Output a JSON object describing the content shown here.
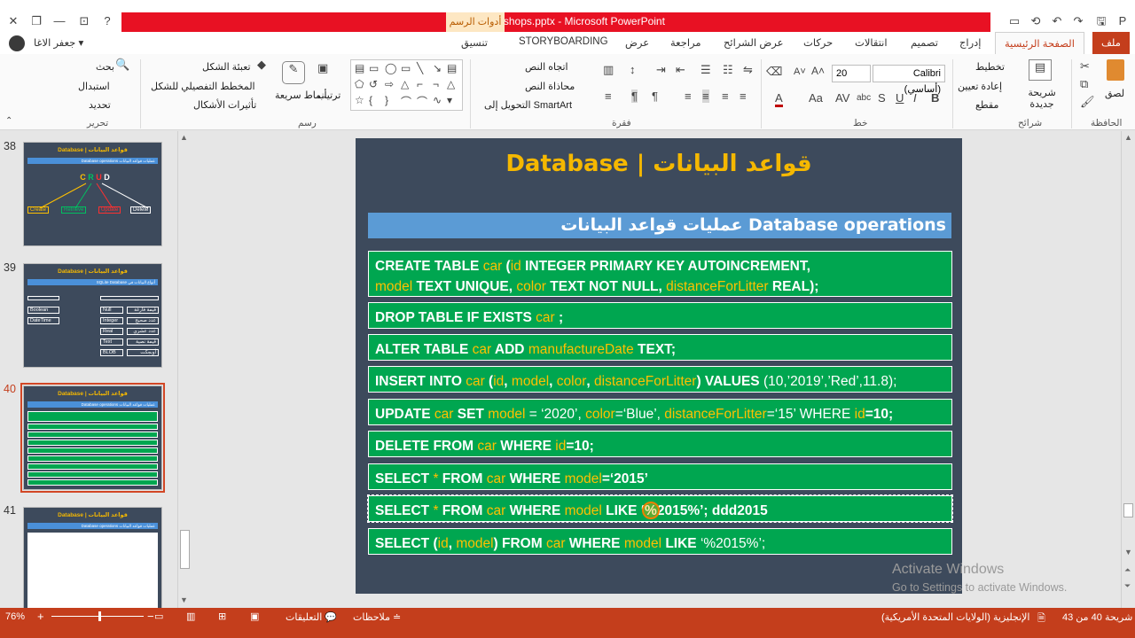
{
  "window": {
    "title": "1 Workshops.pptx  -  Microsoft PowerPoint",
    "context_tab": "أدوات الرسم",
    "user": "جعفر الاغا",
    "help": "?"
  },
  "tabs": {
    "file": "ملف",
    "home": "الصفحة الرئيسية",
    "insert": "إدراج",
    "design": "تصميم",
    "transitions": "انتقالات",
    "animations": "حركات",
    "slideshow": "عرض الشرائح",
    "review": "مراجعة",
    "view": "عرض",
    "storyboarding": "STORYBOARDING",
    "format": "تنسيق"
  },
  "ribbon": {
    "clipboard": {
      "label": "الحافظة",
      "paste": "لصق"
    },
    "slides": {
      "label": "شرائح",
      "new_slide": "شريحة جديدة",
      "layout": "تخطيط",
      "reset": "إعادة تعيين",
      "section": "مقطع"
    },
    "font": {
      "label": "خط",
      "font_name": "Calibri (أساسي)",
      "font_size": "20"
    },
    "paragraph": {
      "label": "فقرة",
      "text_direction": "اتجاه النص",
      "align_text": "محاذاة النص",
      "smartart": "التحويل إلى SmartArt"
    },
    "drawing": {
      "label": "رسم",
      "arrange": "ترتيب",
      "quick_styles": "أنماط سريعة",
      "shape_fill": "تعبئة الشكل",
      "shape_outline": "المخطط التفصيلي للشكل",
      "shape_effects": "تأثيرات الأشكال"
    },
    "editing": {
      "label": "تحرير",
      "find": "بحث",
      "replace": "استبدال",
      "select": "تحديد"
    }
  },
  "thumbnails": [
    {
      "number": "38",
      "title": "Database | قواعد البيانات",
      "band": "Database operations عمليات قواعد البيانات"
    },
    {
      "number": "39",
      "title": "Database | قواعد البيانات",
      "band": "SQLite Database أنواع البيانات في"
    },
    {
      "number": "40",
      "title": "Database | قواعد البيانات",
      "band": "Database operations عمليات قواعد البيانات"
    },
    {
      "number": "41",
      "title": "Database | قواعد البيانات",
      "band": "Database operations عمليات قواعد البيانات"
    }
  ],
  "thumb38": {
    "c": "C",
    "r": "R",
    "u": "U",
    "d": "D",
    "create": "Create",
    "retrieve": "Retrieve",
    "update": "Update",
    "delete": "Delete"
  },
  "thumb39": {
    "boolean": "Boolean",
    "datetime": "DateTime",
    "null": "Null",
    "integer": "Integer",
    "real": "Real",
    "text": "Text",
    "blob": "BLOB",
    "null_ar": "قيمة فارغة",
    "integer_ar": "عدد صحيح",
    "real_ar": "عدد عشري",
    "text_ar": "قيمة نصية",
    "blob_ar": "أوبجكت"
  },
  "slide": {
    "title": "Database  |  قواعد البيانات",
    "band": "عمليات قواعد البيانات Database operations",
    "rows": [
      {
        "l1": [
          "CREATE TABLE ",
          "car",
          " (",
          "id",
          " INTEGER PRIMARY KEY AUTOINCREMENT,"
        ],
        "l2": [
          "model",
          " TEXT UNIQUE, ",
          "color",
          " TEXT NOT NULL, ",
          "distanceForLitter",
          " REAL);"
        ]
      },
      {
        "p": [
          "DROP TABLE IF EXISTS ",
          "car",
          " ;"
        ]
      },
      {
        "p": [
          "ALTER TABLE ",
          "car",
          " ADD ",
          "manufactureDate",
          " TEXT;"
        ]
      },
      {
        "p": [
          "INSERT INTO ",
          "car",
          " (",
          "id",
          ", ",
          "model",
          ", ",
          "color",
          ", ",
          "distanceForLitter",
          ") VALUES ",
          "(10,’2019’,’Red’,11.8);"
        ]
      },
      {
        "p": [
          "UPDATE ",
          "car",
          " SET ",
          "model",
          " = ‘2020’, ",
          "color",
          "=‘Blue’, ",
          "distanceForLitter",
          "=‘15’ WHERE ",
          "id",
          "=10;"
        ]
      },
      {
        "p": [
          "DELETE FROM ",
          "car",
          " WHERE ",
          "id",
          "=10;"
        ]
      },
      {
        "p": [
          "SELECT ",
          "*",
          " FROM ",
          "car",
          " WHERE ",
          "model",
          "=‘2015’"
        ]
      },
      {
        "p": [
          "SELECT ",
          "*",
          " FROM ",
          "car",
          " WHERE ",
          "model",
          " LIKE ",
          "‘%2015%’; ddd2015"
        ]
      },
      {
        "p": [
          "SELECT (",
          "id",
          ", ",
          "model",
          ") FROM ",
          "car",
          " WHERE ",
          "model",
          " LIKE ",
          "‘%2015%’;"
        ]
      }
    ]
  },
  "watermark": {
    "line1": "Activate Windows",
    "line2": "Go to Settings to activate Windows."
  },
  "status": {
    "zoom": "76%",
    "comments": "التعليقات",
    "notes": "ملاحظات",
    "language": "الإنجليزية (الولايات المتحدة الأمريكية)",
    "slide_info": "شريحة 40 من 43"
  },
  "colors": {
    "accent": "#c43e1c",
    "slide_bg": "#3d4a5c",
    "row_green": "#00a650",
    "keyword_yellow": "#ffc000",
    "band_blue": "#5b9bd5",
    "title_gold": "#f5b800"
  }
}
